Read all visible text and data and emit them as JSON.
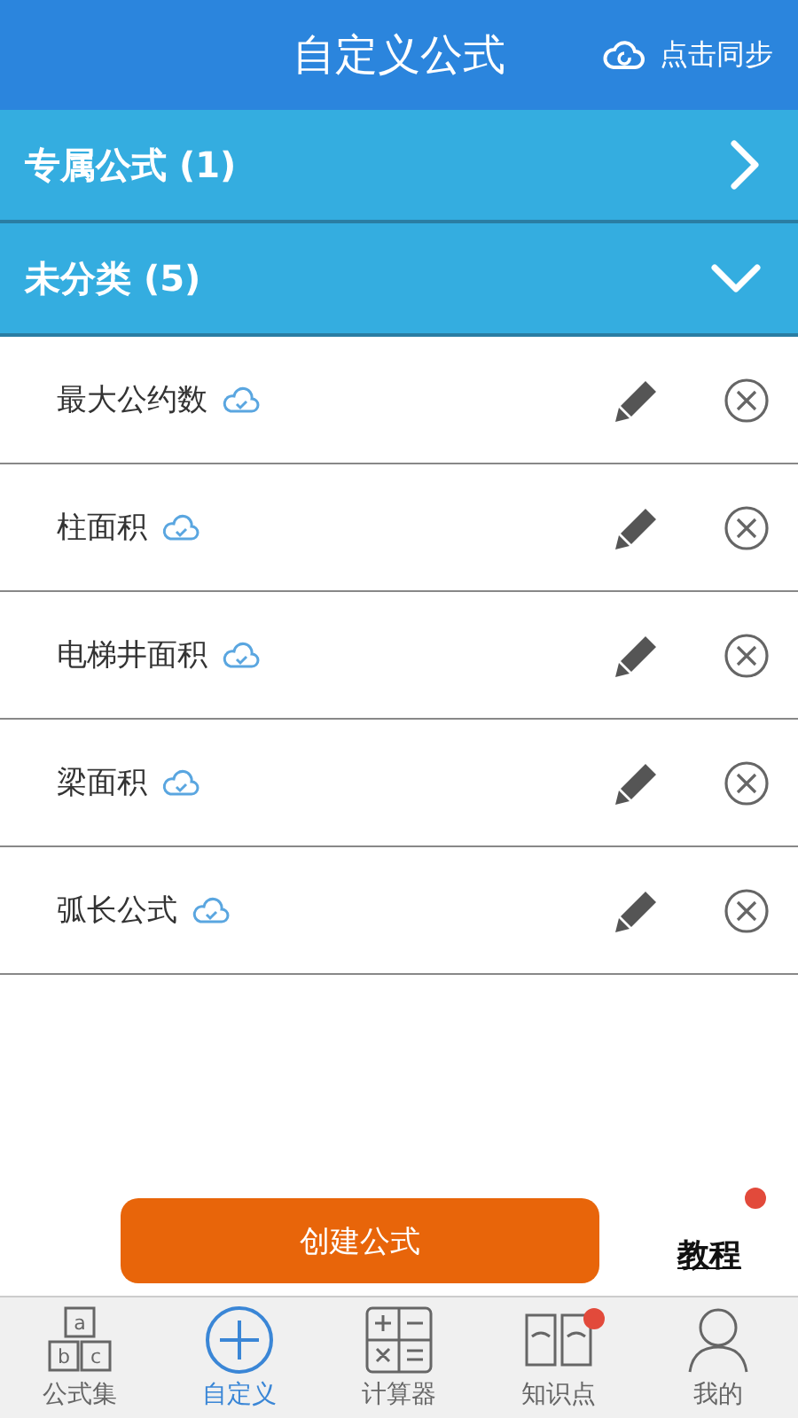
{
  "header": {
    "title": "自定义公式",
    "sync_label": "点击同步"
  },
  "sections": [
    {
      "label": "专属公式 (1)",
      "expanded": false
    },
    {
      "label": "未分类 (5)",
      "expanded": true
    }
  ],
  "formulas": [
    {
      "name": "最大公约数"
    },
    {
      "name": "柱面积"
    },
    {
      "name": "电梯井面积"
    },
    {
      "name": "梁面积"
    },
    {
      "name": "弧长公式"
    }
  ],
  "create_button": "创建公式",
  "tutorial": {
    "label": "教程",
    "badge": true
  },
  "tabs": [
    {
      "label": "公式集",
      "kind": "blocks",
      "glyphs": [
        "a",
        "b",
        "c"
      ],
      "selected": false,
      "badge": false
    },
    {
      "label": "自定义",
      "kind": "plus",
      "selected": true,
      "badge": false
    },
    {
      "label": "计算器",
      "kind": "calculator",
      "selected": false,
      "badge": false
    },
    {
      "label": "知识点",
      "kind": "book",
      "selected": false,
      "badge": true
    },
    {
      "label": "我的",
      "kind": "person",
      "selected": false,
      "badge": false
    }
  ]
}
